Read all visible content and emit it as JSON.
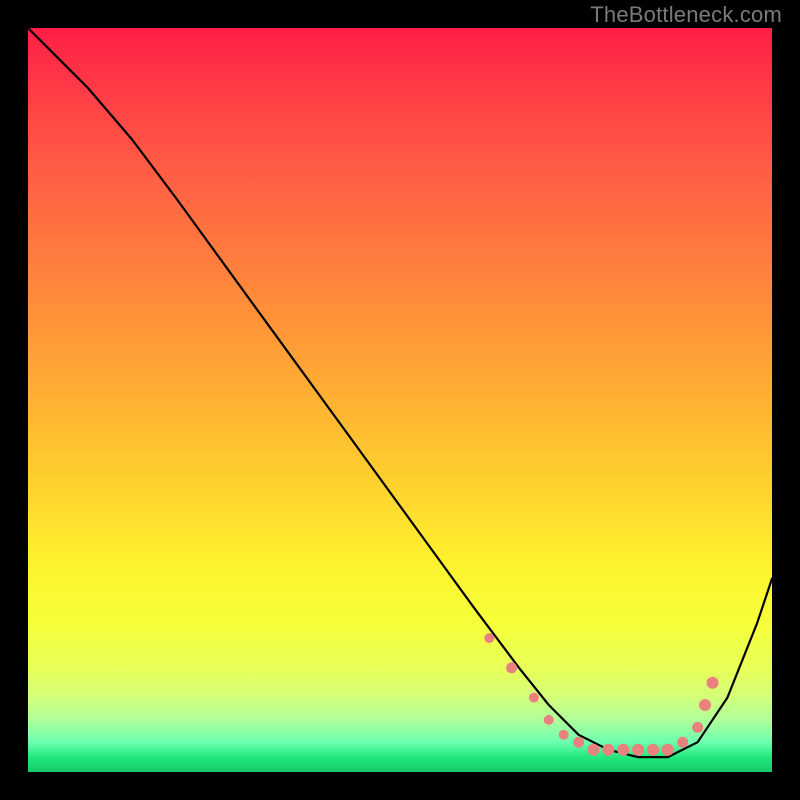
{
  "watermark": "TheBottleneck.com",
  "chart_data": {
    "type": "line",
    "title": "",
    "xlabel": "",
    "ylabel": "",
    "xlim": [
      0,
      100
    ],
    "ylim": [
      0,
      100
    ],
    "grid": false,
    "legend": false,
    "series": [
      {
        "name": "curve",
        "x": [
          0,
          4,
          8,
          14,
          20,
          28,
          36,
          44,
          52,
          60,
          66,
          70,
          74,
          78,
          82,
          86,
          90,
          94,
          98,
          100
        ],
        "y": [
          100,
          96,
          92,
          85,
          77,
          66,
          55,
          44,
          33,
          22,
          14,
          9,
          5,
          3,
          2,
          2,
          4,
          10,
          20,
          26
        ]
      }
    ],
    "markers": {
      "name": "dots",
      "x": [
        62,
        65,
        68,
        70,
        72,
        74,
        76,
        78,
        80,
        82,
        84,
        86,
        88,
        90,
        91,
        92
      ],
      "y": [
        18,
        14,
        10,
        7,
        5,
        4,
        3,
        3,
        3,
        3,
        3,
        3,
        4,
        6,
        9,
        12
      ],
      "r": [
        5,
        5.5,
        5,
        5,
        5,
        5.5,
        6,
        6,
        6,
        6,
        6,
        6,
        5.5,
        5.5,
        6,
        6
      ]
    },
    "background_gradient": {
      "direction": "vertical",
      "stops": [
        {
          "pos": 0.0,
          "color": "#ff1e44"
        },
        {
          "pos": 0.3,
          "color": "#ff7a3e"
        },
        {
          "pos": 0.6,
          "color": "#ffce2e"
        },
        {
          "pos": 0.8,
          "color": "#f6ff3a"
        },
        {
          "pos": 0.96,
          "color": "#6cffb0"
        },
        {
          "pos": 1.0,
          "color": "#17c96b"
        }
      ]
    }
  }
}
